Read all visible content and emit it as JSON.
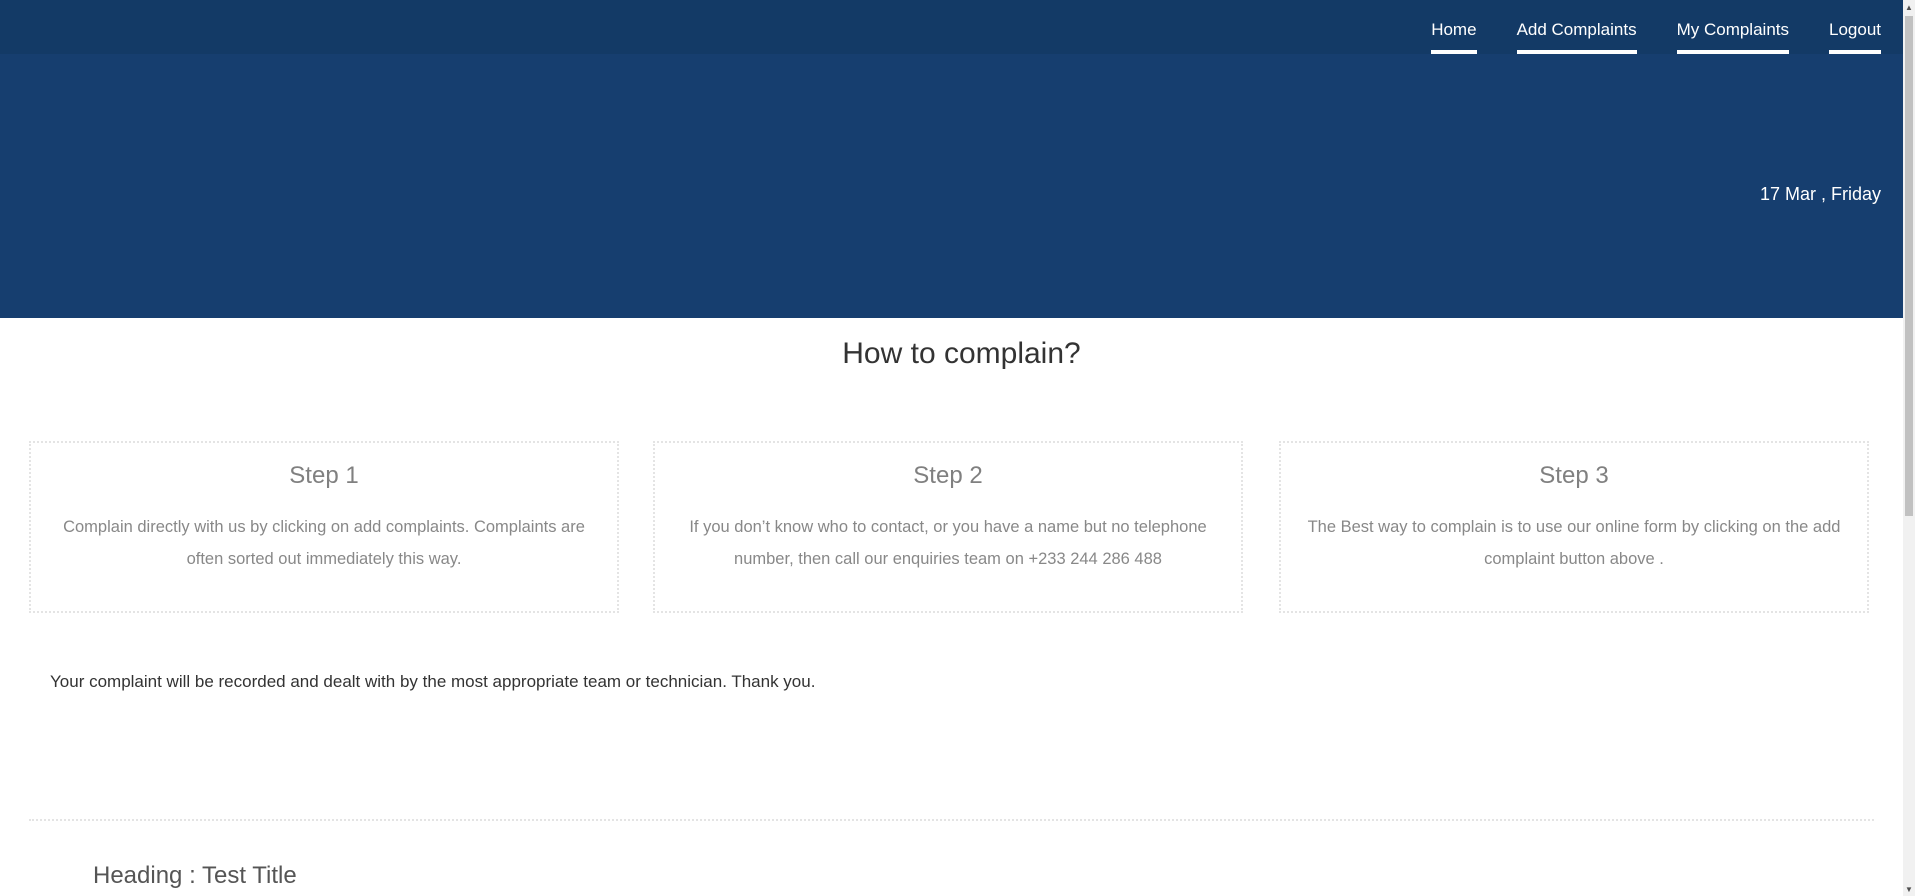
{
  "nav": {
    "items": [
      {
        "label": "Home"
      },
      {
        "label": "Add Complaints"
      },
      {
        "label": "My Complaints"
      },
      {
        "label": "Logout"
      }
    ]
  },
  "hero": {
    "date": "17 Mar , Friday"
  },
  "main": {
    "title": "How to complain?",
    "steps": [
      {
        "title": "Step 1",
        "text": "Complain directly with us by clicking on add complaints. Complaints are often sorted out immediately this way."
      },
      {
        "title": "Step 2",
        "text": "If you don’t know who to contact, or you have a name but no telephone number, then call our enquiries team on +233 244 286 488"
      },
      {
        "title": "Step 3",
        "text": "The Best way to complain is to use our online form by clicking on the add complaint button above ."
      }
    ],
    "thanks": "Your complaint will be recorded and dealt with by the most appropriate team or technician. Thank you.",
    "heading": "Heading : Test Title"
  },
  "colors": {
    "topbar": "#133a66",
    "hero": "#163e6f",
    "step_border": "#e4e4e4"
  },
  "icons": {
    "scroll_up": "triangle-up-icon",
    "scroll_down": "triangle-down-icon"
  }
}
